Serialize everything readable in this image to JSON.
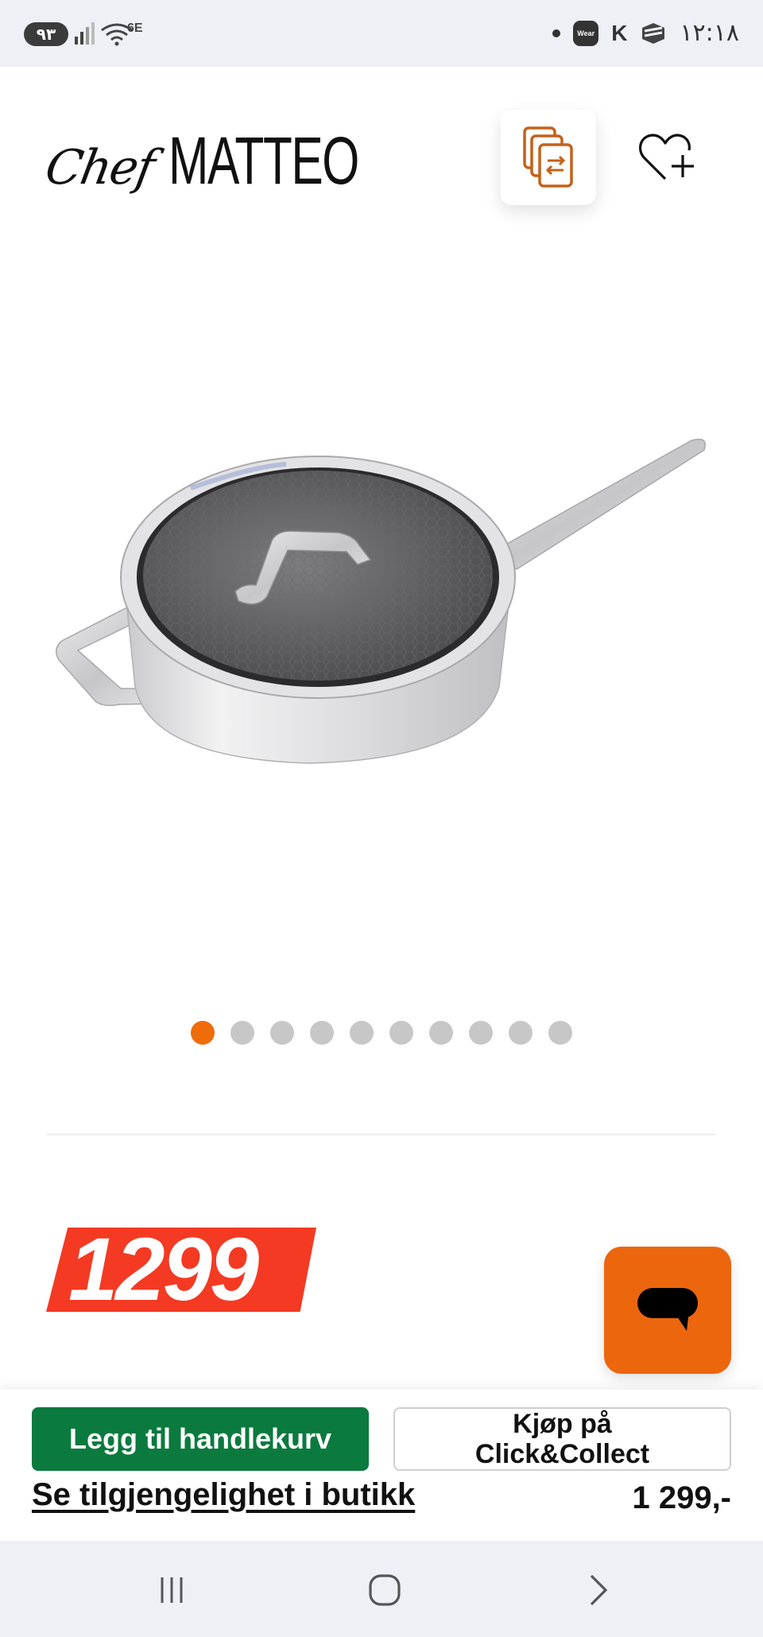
{
  "status_bar": {
    "battery": "۹۳",
    "network": "6E",
    "wear_label": "Wear",
    "k_label": "K",
    "time": "۱۲:۱۸"
  },
  "header": {
    "logo_script": "Chef",
    "logo_brand": "MATTEO",
    "compare_icon": "compare-documents-icon",
    "wishlist_icon": "heart-plus-icon"
  },
  "gallery": {
    "image": "saute-pan-with-glass-lid",
    "slide_count": 10,
    "active_slide": 1
  },
  "price_badge": {
    "value": "1299"
  },
  "chat": {
    "icon": "chat-bubble-icon"
  },
  "buy_bar": {
    "add_to_cart": "Legg til handlekurv",
    "click_collect_line1": "Kjøp på",
    "click_collect_line2": "Click&Collect",
    "store_availability": "Se tilgjengelighet i butikk",
    "price": "1 299,-"
  },
  "colors": {
    "accent_orange": "#ec660e",
    "price_red": "#f43a23",
    "cart_green": "#0b7a3e"
  }
}
